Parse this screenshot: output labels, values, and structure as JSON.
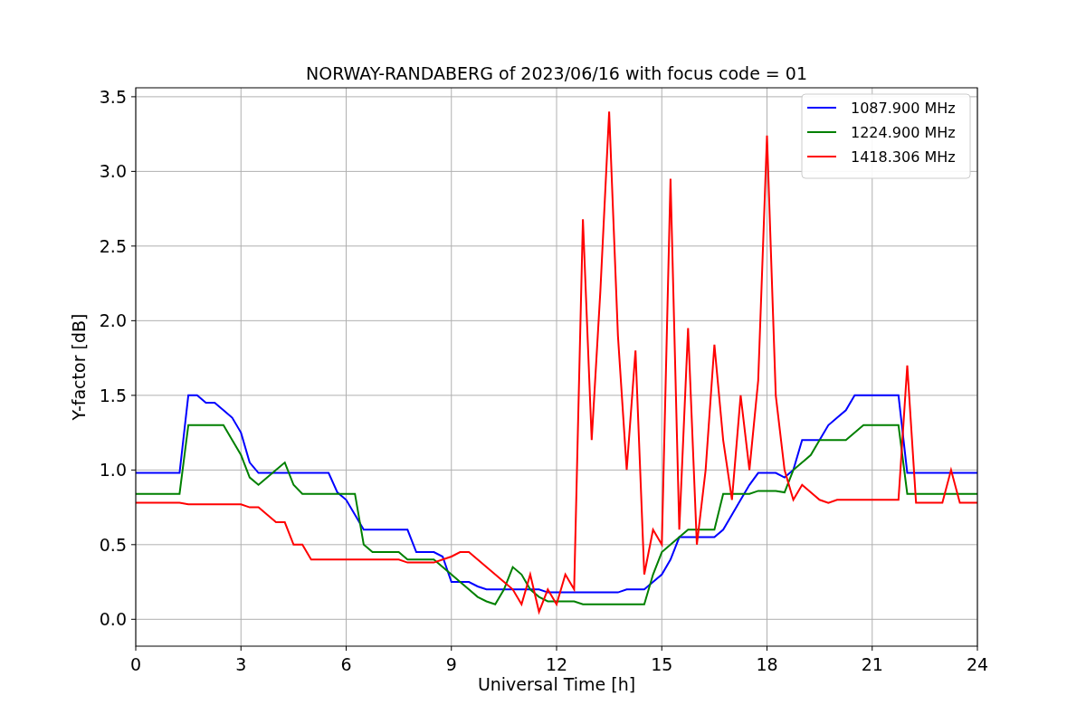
{
  "figure": {
    "chart_data": {
      "type": "line",
      "title": "NORWAY-RANDABERG of 2023/06/16 with focus code = 01",
      "xlabel": "Universal Time [h]",
      "ylabel": "Y-factor [dB]",
      "x": [
        0,
        0.25,
        0.5,
        0.75,
        1,
        1.25,
        1.5,
        1.75,
        2,
        2.25,
        2.5,
        2.75,
        3,
        3.25,
        3.5,
        3.75,
        4,
        4.25,
        4.5,
        4.75,
        5,
        5.25,
        5.5,
        5.75,
        6,
        6.25,
        6.5,
        6.75,
        7,
        7.25,
        7.5,
        7.75,
        8,
        8.25,
        8.5,
        8.75,
        9,
        9.25,
        9.5,
        9.75,
        10,
        10.25,
        10.5,
        10.75,
        11,
        11.25,
        11.5,
        11.75,
        12,
        12.25,
        12.5,
        12.75,
        13,
        13.25,
        13.5,
        13.75,
        14,
        14.25,
        14.5,
        14.75,
        15,
        15.25,
        15.5,
        15.75,
        16,
        16.25,
        16.5,
        16.75,
        17,
        17.25,
        17.5,
        17.75,
        18,
        18.25,
        18.5,
        18.75,
        19,
        19.25,
        19.5,
        19.75,
        20,
        20.25,
        20.5,
        20.75,
        21,
        21.25,
        21.5,
        21.75,
        22,
        22.25,
        22.5,
        22.75,
        23,
        23.25,
        23.5,
        23.75,
        24
      ],
      "series": [
        {
          "name": "1087.900 MHz",
          "color": "#0000ff",
          "values": [
            0.98,
            0.98,
            0.98,
            0.98,
            0.98,
            0.98,
            1.5,
            1.5,
            1.45,
            1.45,
            1.4,
            1.35,
            1.25,
            1.05,
            0.98,
            0.98,
            0.98,
            0.98,
            0.98,
            0.98,
            0.98,
            0.98,
            0.98,
            0.85,
            0.8,
            0.7,
            0.6,
            0.6,
            0.6,
            0.6,
            0.6,
            0.6,
            0.45,
            0.45,
            0.45,
            0.42,
            0.25,
            0.25,
            0.25,
            0.22,
            0.2,
            0.2,
            0.2,
            0.2,
            0.2,
            0.2,
            0.2,
            0.18,
            0.18,
            0.18,
            0.18,
            0.18,
            0.18,
            0.18,
            0.18,
            0.18,
            0.2,
            0.2,
            0.2,
            0.25,
            0.3,
            0.4,
            0.55,
            0.55,
            0.55,
            0.55,
            0.55,
            0.6,
            0.7,
            0.8,
            0.9,
            0.98,
            0.98,
            0.98,
            0.95,
            1.0,
            1.2,
            1.2,
            1.2,
            1.3,
            1.35,
            1.4,
            1.5,
            1.5,
            1.5,
            1.5,
            1.5,
            1.5,
            0.98,
            0.98,
            0.98,
            0.98,
            0.98,
            0.98,
            0.98,
            0.98,
            0.98
          ]
        },
        {
          "name": "1224.900 MHz",
          "color": "#008000",
          "values": [
            0.84,
            0.84,
            0.84,
            0.84,
            0.84,
            0.84,
            1.3,
            1.3,
            1.3,
            1.3,
            1.3,
            1.2,
            1.1,
            0.95,
            0.9,
            0.95,
            1.0,
            1.05,
            0.9,
            0.84,
            0.84,
            0.84,
            0.84,
            0.84,
            0.84,
            0.84,
            0.5,
            0.45,
            0.45,
            0.45,
            0.45,
            0.4,
            0.4,
            0.4,
            0.4,
            0.35,
            0.3,
            0.25,
            0.2,
            0.15,
            0.12,
            0.1,
            0.2,
            0.35,
            0.3,
            0.2,
            0.15,
            0.12,
            0.12,
            0.12,
            0.12,
            0.1,
            0.1,
            0.1,
            0.1,
            0.1,
            0.1,
            0.1,
            0.1,
            0.3,
            0.45,
            0.5,
            0.55,
            0.6,
            0.6,
            0.6,
            0.6,
            0.84,
            0.84,
            0.84,
            0.84,
            0.86,
            0.86,
            0.86,
            0.85,
            1.0,
            1.05,
            1.1,
            1.2,
            1.2,
            1.2,
            1.2,
            1.25,
            1.3,
            1.3,
            1.3,
            1.3,
            1.3,
            0.84,
            0.84,
            0.84,
            0.84,
            0.84,
            0.84,
            0.84,
            0.84,
            0.84
          ]
        },
        {
          "name": "1418.306 MHz",
          "color": "#ff0000",
          "values": [
            0.78,
            0.78,
            0.78,
            0.78,
            0.78,
            0.78,
            0.77,
            0.77,
            0.77,
            0.77,
            0.77,
            0.77,
            0.77,
            0.75,
            0.75,
            0.7,
            0.65,
            0.65,
            0.5,
            0.5,
            0.4,
            0.4,
            0.4,
            0.4,
            0.4,
            0.4,
            0.4,
            0.4,
            0.4,
            0.4,
            0.4,
            0.38,
            0.38,
            0.38,
            0.38,
            0.4,
            0.42,
            0.45,
            0.45,
            0.4,
            0.35,
            0.3,
            0.25,
            0.2,
            0.1,
            0.3,
            0.05,
            0.2,
            0.1,
            0.3,
            0.2,
            2.68,
            1.2,
            2.2,
            3.4,
            1.9,
            1.0,
            1.8,
            0.3,
            0.6,
            0.5,
            2.95,
            0.6,
            1.95,
            0.5,
            1.0,
            1.84,
            1.2,
            0.8,
            1.5,
            1.0,
            1.6,
            3.24,
            1.5,
            1.0,
            0.8,
            0.9,
            0.85,
            0.8,
            0.78,
            0.8,
            0.8,
            0.8,
            0.8,
            0.8,
            0.8,
            0.8,
            0.8,
            1.7,
            0.78,
            0.78,
            0.78,
            0.78,
            1.0,
            0.78,
            0.78,
            0.78
          ]
        }
      ],
      "grid": true,
      "legend": true,
      "xlim": [
        0,
        24
      ],
      "ylim": [
        -0.18,
        3.56
      ],
      "xticks": [
        0,
        3,
        6,
        9,
        12,
        15,
        18,
        21,
        24
      ],
      "yticks": [
        {
          "value": 0,
          "label": "0.0"
        },
        {
          "value": 0.5,
          "label": "0.5"
        },
        {
          "value": 1,
          "label": "1.0"
        },
        {
          "value": 1.5,
          "label": "1.5"
        },
        {
          "value": 2,
          "label": "2.0"
        },
        {
          "value": 2.5,
          "label": "2.5"
        },
        {
          "value": 3,
          "label": "3.0"
        },
        {
          "value": 3.5,
          "label": "3.5"
        }
      ]
    }
  }
}
